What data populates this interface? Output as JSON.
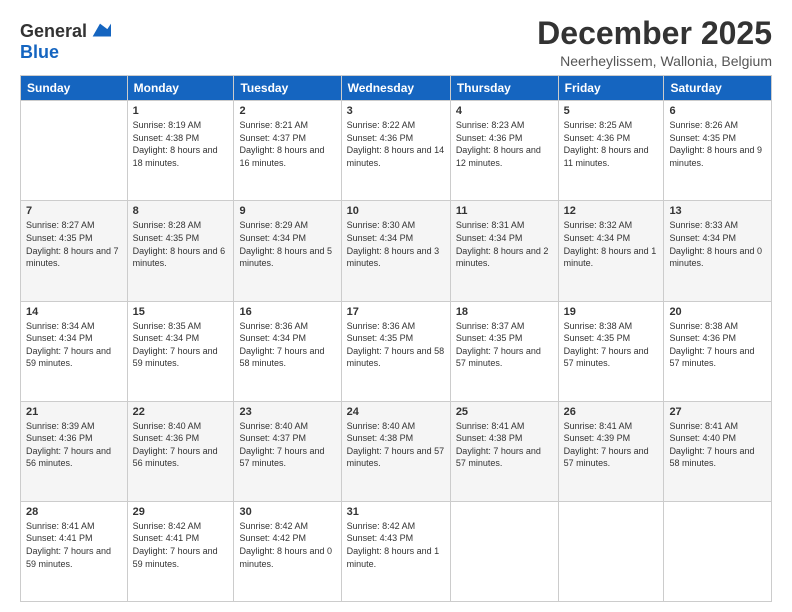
{
  "logo": {
    "general": "General",
    "blue": "Blue"
  },
  "header": {
    "title": "December 2025",
    "subtitle": "Neerheylissem, Wallonia, Belgium"
  },
  "weekdays": [
    "Sunday",
    "Monday",
    "Tuesday",
    "Wednesday",
    "Thursday",
    "Friday",
    "Saturday"
  ],
  "weeks": [
    [
      {
        "day": "",
        "sunrise": "",
        "sunset": "",
        "daylight": ""
      },
      {
        "day": "1",
        "sunrise": "Sunrise: 8:19 AM",
        "sunset": "Sunset: 4:38 PM",
        "daylight": "Daylight: 8 hours and 18 minutes."
      },
      {
        "day": "2",
        "sunrise": "Sunrise: 8:21 AM",
        "sunset": "Sunset: 4:37 PM",
        "daylight": "Daylight: 8 hours and 16 minutes."
      },
      {
        "day": "3",
        "sunrise": "Sunrise: 8:22 AM",
        "sunset": "Sunset: 4:36 PM",
        "daylight": "Daylight: 8 hours and 14 minutes."
      },
      {
        "day": "4",
        "sunrise": "Sunrise: 8:23 AM",
        "sunset": "Sunset: 4:36 PM",
        "daylight": "Daylight: 8 hours and 12 minutes."
      },
      {
        "day": "5",
        "sunrise": "Sunrise: 8:25 AM",
        "sunset": "Sunset: 4:36 PM",
        "daylight": "Daylight: 8 hours and 11 minutes."
      },
      {
        "day": "6",
        "sunrise": "Sunrise: 8:26 AM",
        "sunset": "Sunset: 4:35 PM",
        "daylight": "Daylight: 8 hours and 9 minutes."
      }
    ],
    [
      {
        "day": "7",
        "sunrise": "Sunrise: 8:27 AM",
        "sunset": "Sunset: 4:35 PM",
        "daylight": "Daylight: 8 hours and 7 minutes."
      },
      {
        "day": "8",
        "sunrise": "Sunrise: 8:28 AM",
        "sunset": "Sunset: 4:35 PM",
        "daylight": "Daylight: 8 hours and 6 minutes."
      },
      {
        "day": "9",
        "sunrise": "Sunrise: 8:29 AM",
        "sunset": "Sunset: 4:34 PM",
        "daylight": "Daylight: 8 hours and 5 minutes."
      },
      {
        "day": "10",
        "sunrise": "Sunrise: 8:30 AM",
        "sunset": "Sunset: 4:34 PM",
        "daylight": "Daylight: 8 hours and 3 minutes."
      },
      {
        "day": "11",
        "sunrise": "Sunrise: 8:31 AM",
        "sunset": "Sunset: 4:34 PM",
        "daylight": "Daylight: 8 hours and 2 minutes."
      },
      {
        "day": "12",
        "sunrise": "Sunrise: 8:32 AM",
        "sunset": "Sunset: 4:34 PM",
        "daylight": "Daylight: 8 hours and 1 minute."
      },
      {
        "day": "13",
        "sunrise": "Sunrise: 8:33 AM",
        "sunset": "Sunset: 4:34 PM",
        "daylight": "Daylight: 8 hours and 0 minutes."
      }
    ],
    [
      {
        "day": "14",
        "sunrise": "Sunrise: 8:34 AM",
        "sunset": "Sunset: 4:34 PM",
        "daylight": "Daylight: 7 hours and 59 minutes."
      },
      {
        "day": "15",
        "sunrise": "Sunrise: 8:35 AM",
        "sunset": "Sunset: 4:34 PM",
        "daylight": "Daylight: 7 hours and 59 minutes."
      },
      {
        "day": "16",
        "sunrise": "Sunrise: 8:36 AM",
        "sunset": "Sunset: 4:34 PM",
        "daylight": "Daylight: 7 hours and 58 minutes."
      },
      {
        "day": "17",
        "sunrise": "Sunrise: 8:36 AM",
        "sunset": "Sunset: 4:35 PM",
        "daylight": "Daylight: 7 hours and 58 minutes."
      },
      {
        "day": "18",
        "sunrise": "Sunrise: 8:37 AM",
        "sunset": "Sunset: 4:35 PM",
        "daylight": "Daylight: 7 hours and 57 minutes."
      },
      {
        "day": "19",
        "sunrise": "Sunrise: 8:38 AM",
        "sunset": "Sunset: 4:35 PM",
        "daylight": "Daylight: 7 hours and 57 minutes."
      },
      {
        "day": "20",
        "sunrise": "Sunrise: 8:38 AM",
        "sunset": "Sunset: 4:36 PM",
        "daylight": "Daylight: 7 hours and 57 minutes."
      }
    ],
    [
      {
        "day": "21",
        "sunrise": "Sunrise: 8:39 AM",
        "sunset": "Sunset: 4:36 PM",
        "daylight": "Daylight: 7 hours and 56 minutes."
      },
      {
        "day": "22",
        "sunrise": "Sunrise: 8:40 AM",
        "sunset": "Sunset: 4:36 PM",
        "daylight": "Daylight: 7 hours and 56 minutes."
      },
      {
        "day": "23",
        "sunrise": "Sunrise: 8:40 AM",
        "sunset": "Sunset: 4:37 PM",
        "daylight": "Daylight: 7 hours and 57 minutes."
      },
      {
        "day": "24",
        "sunrise": "Sunrise: 8:40 AM",
        "sunset": "Sunset: 4:38 PM",
        "daylight": "Daylight: 7 hours and 57 minutes."
      },
      {
        "day": "25",
        "sunrise": "Sunrise: 8:41 AM",
        "sunset": "Sunset: 4:38 PM",
        "daylight": "Daylight: 7 hours and 57 minutes."
      },
      {
        "day": "26",
        "sunrise": "Sunrise: 8:41 AM",
        "sunset": "Sunset: 4:39 PM",
        "daylight": "Daylight: 7 hours and 57 minutes."
      },
      {
        "day": "27",
        "sunrise": "Sunrise: 8:41 AM",
        "sunset": "Sunset: 4:40 PM",
        "daylight": "Daylight: 7 hours and 58 minutes."
      }
    ],
    [
      {
        "day": "28",
        "sunrise": "Sunrise: 8:41 AM",
        "sunset": "Sunset: 4:41 PM",
        "daylight": "Daylight: 7 hours and 59 minutes."
      },
      {
        "day": "29",
        "sunrise": "Sunrise: 8:42 AM",
        "sunset": "Sunset: 4:41 PM",
        "daylight": "Daylight: 7 hours and 59 minutes."
      },
      {
        "day": "30",
        "sunrise": "Sunrise: 8:42 AM",
        "sunset": "Sunset: 4:42 PM",
        "daylight": "Daylight: 8 hours and 0 minutes."
      },
      {
        "day": "31",
        "sunrise": "Sunrise: 8:42 AM",
        "sunset": "Sunset: 4:43 PM",
        "daylight": "Daylight: 8 hours and 1 minute."
      },
      {
        "day": "",
        "sunrise": "",
        "sunset": "",
        "daylight": ""
      },
      {
        "day": "",
        "sunrise": "",
        "sunset": "",
        "daylight": ""
      },
      {
        "day": "",
        "sunrise": "",
        "sunset": "",
        "daylight": ""
      }
    ]
  ]
}
